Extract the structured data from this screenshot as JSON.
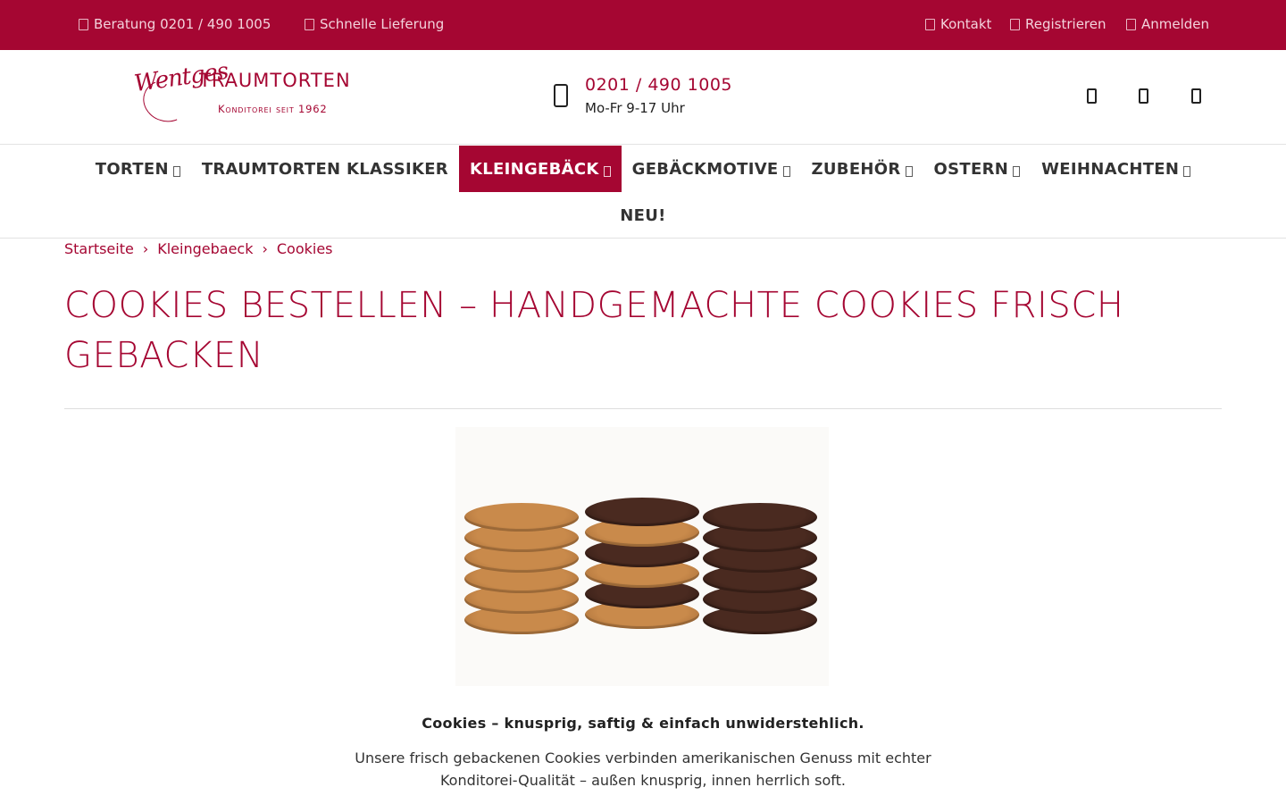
{
  "topbar": {
    "beratung": "Beratung 0201 / 490 1005",
    "lieferung": "Schnelle Lieferung",
    "kontakt": "Kontakt",
    "registrieren": "Registrieren",
    "anmelden": "Anmelden"
  },
  "logo": {
    "script": "Wentges",
    "brand": "TRAUMTORTEN",
    "tagline": "Konditorei seit 1962"
  },
  "contact": {
    "phone": "0201 / 490 1005",
    "hours": "Mo-Fr 9-17 Uhr"
  },
  "nav": {
    "items": [
      {
        "label": "TORTEN",
        "caret": true,
        "active": false
      },
      {
        "label": "TRAUMTORTEN KLASSIKER",
        "caret": false,
        "active": false
      },
      {
        "label": "KLEINGEBÄCK",
        "caret": true,
        "active": true
      },
      {
        "label": "GEBÄCKMOTIVE",
        "caret": true,
        "active": false
      },
      {
        "label": "ZUBEHÖR",
        "caret": true,
        "active": false
      },
      {
        "label": "OSTERN",
        "caret": true,
        "active": false
      },
      {
        "label": "WEIHNACHTEN",
        "caret": true,
        "active": false
      }
    ],
    "neu": "NEU!"
  },
  "breadcrumb": {
    "home": "Startseite",
    "category": "Kleingebaeck",
    "current": "Cookies",
    "separator": "›"
  },
  "page": {
    "title": "COOKIES BESTELLEN – HANDGEMACHTE COOKIES FRISCH GEBACKEN",
    "lead": "Cookies – knusprig, saftig & einfach unwiderstehlich.",
    "description": "Unsere frisch gebackenen Cookies verbinden amerikanischen Genuss mit echter Konditorei-Qualität – außen knusprig, innen herrlich soft."
  },
  "colors": {
    "brand": "#a50632",
    "cookie_light": "#c98a4b",
    "cookie_dark": "#4a2a20"
  },
  "icons": [
    "phone-icon",
    "truck-icon",
    "envelope-icon",
    "user-plus-icon",
    "sign-in-icon",
    "search-icon",
    "heart-icon",
    "cart-icon",
    "caret-down-icon"
  ]
}
